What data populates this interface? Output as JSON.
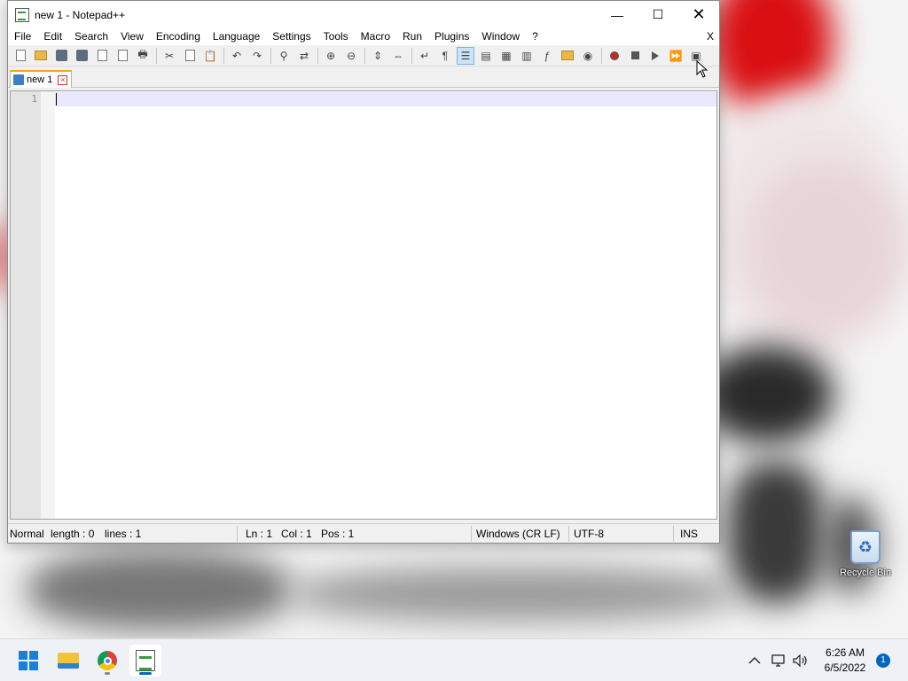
{
  "window": {
    "title": "new 1 - Notepad++",
    "minimize_glyph": "—",
    "maximize_glyph": "☐",
    "close_glyph": "✕"
  },
  "menu": {
    "items": [
      "File",
      "Edit",
      "Search",
      "View",
      "Encoding",
      "Language",
      "Settings",
      "Tools",
      "Macro",
      "Run",
      "Plugins",
      "Window",
      "?"
    ],
    "close_label": "X"
  },
  "toolbar": {
    "icons": [
      "new-file-icon",
      "open-file-icon",
      "save-icon",
      "save-all-icon",
      "close-icon",
      "close-all-icon",
      "print-icon",
      "cut-icon",
      "copy-icon",
      "paste-icon",
      "undo-icon",
      "redo-icon",
      "find-icon",
      "replace-icon",
      "zoom-in-icon",
      "zoom-out-icon",
      "sync-vertical-icon",
      "sync-horizontal-icon",
      "word-wrap-icon",
      "show-all-characters-icon",
      "indent-guide-icon",
      "user-defined-language-icon",
      "document-map-icon",
      "document-list-icon",
      "function-list-icon",
      "folder-as-workspace-icon",
      "monitoring-icon",
      "record-macro-icon",
      "stop-recording-icon",
      "playback-macro-icon",
      "run-macro-multiple-icon",
      "save-macro-icon"
    ]
  },
  "tab": {
    "label": "new 1"
  },
  "editor": {
    "line_number": "1",
    "content": ""
  },
  "status": {
    "mode": "Normal",
    "length": "length : 0",
    "lines": "lines : 1",
    "ln": "Ln : 1",
    "col": "Col : 1",
    "pos": "Pos : 1",
    "eol": "Windows (CR LF)",
    "encoding": "UTF-8",
    "insert_mode": "INS"
  },
  "desktop": {
    "recycle_bin_label": "Recycle Bin"
  },
  "taskbar": {
    "time": "6:26 AM",
    "date": "6/5/2022",
    "notification_count": "1",
    "apps": [
      "start-button",
      "file-explorer",
      "google-chrome",
      "notepad-plus-plus"
    ]
  },
  "colors": {
    "accent": "#0067c0",
    "tab_highlight": "#f5a623",
    "current_line": "#e8e8ff"
  }
}
